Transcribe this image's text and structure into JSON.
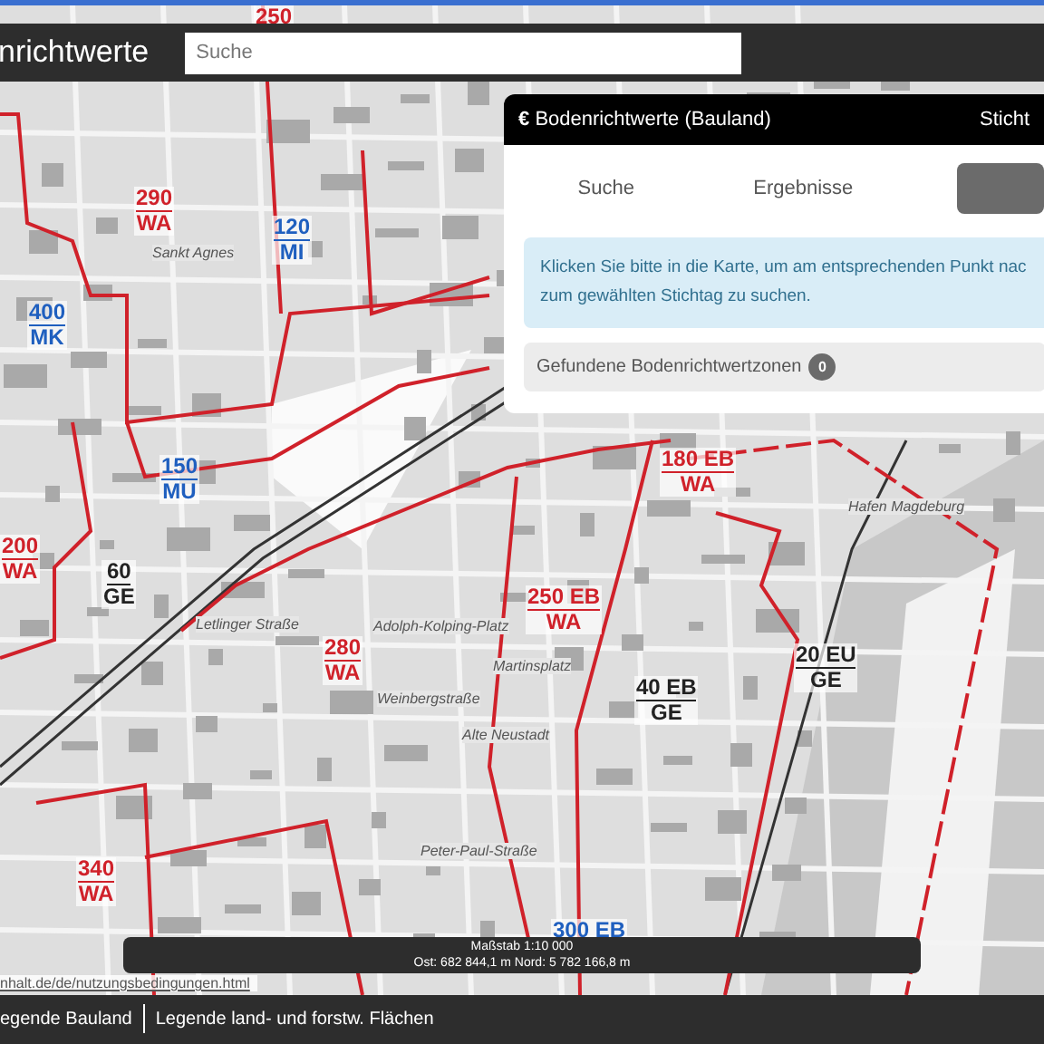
{
  "header": {
    "title": "nrichtwerte",
    "search": {
      "placeholder": "Suche"
    }
  },
  "panel": {
    "title": "Bodenrichtwerte (Bauland)",
    "title_icon": "€",
    "right_label": "Sticht",
    "tabs": [
      {
        "label": "Suche",
        "selected": false
      },
      {
        "label": "Ergebnisse",
        "selected": false
      },
      {
        "selected": true
      }
    ],
    "info": "Klicken Sie bitte in die Karte, um am entsprechenden Punkt nac zum gewählten Stichtag zu suchen.",
    "results": {
      "label": "Gefundene Bodenrichtwertzonen",
      "count": "0"
    }
  },
  "map": {
    "zones": [
      {
        "value": "250",
        "color": "#d0212a"
      },
      {
        "value": "290",
        "use": "WA",
        "color": "#d0212a"
      },
      {
        "value": "120",
        "use": "MI",
        "color": "#1f5fbf"
      },
      {
        "value": "400",
        "use": "MK",
        "color": "#1f5fbf"
      },
      {
        "value": "150",
        "use": "MU",
        "color": "#1f5fbf"
      },
      {
        "value": "200",
        "use": "WA",
        "color": "#d0212a"
      },
      {
        "value": "60",
        "use": "GE",
        "color": "#222222"
      },
      {
        "value": "180 EB",
        "use": "WA",
        "color": "#d0212a"
      },
      {
        "value": "250 EB",
        "use": "WA",
        "color": "#d0212a"
      },
      {
        "value": "280",
        "use": "WA",
        "color": "#d0212a"
      },
      {
        "value": "40 EB",
        "use": "GE",
        "color": "#222222"
      },
      {
        "value": "20 EU",
        "use": "GE",
        "color": "#222222"
      },
      {
        "value": "340",
        "use": "WA",
        "color": "#d0212a"
      },
      {
        "value": "300 EB",
        "color": "#1f5fbf"
      }
    ],
    "places": [
      "Sankt Agnes",
      "Hafen Magdeburg",
      "Letlinger Straße",
      "Adolph-Kolping-Platz",
      "Martinsplatz",
      "Weinbergstraße",
      "Alte Neustadt",
      "Peter-Paul-Straße"
    ],
    "scale": "Maßstab 1:10 000",
    "coordinates": "Ost: 682 844,1 m Nord: 5 782 166,8 m",
    "attribution": "nhalt.de/de/nutzungsbedingungen.html"
  },
  "footer": {
    "links": [
      "egende Bauland",
      "Legende land- und forstw. Flächen"
    ]
  }
}
